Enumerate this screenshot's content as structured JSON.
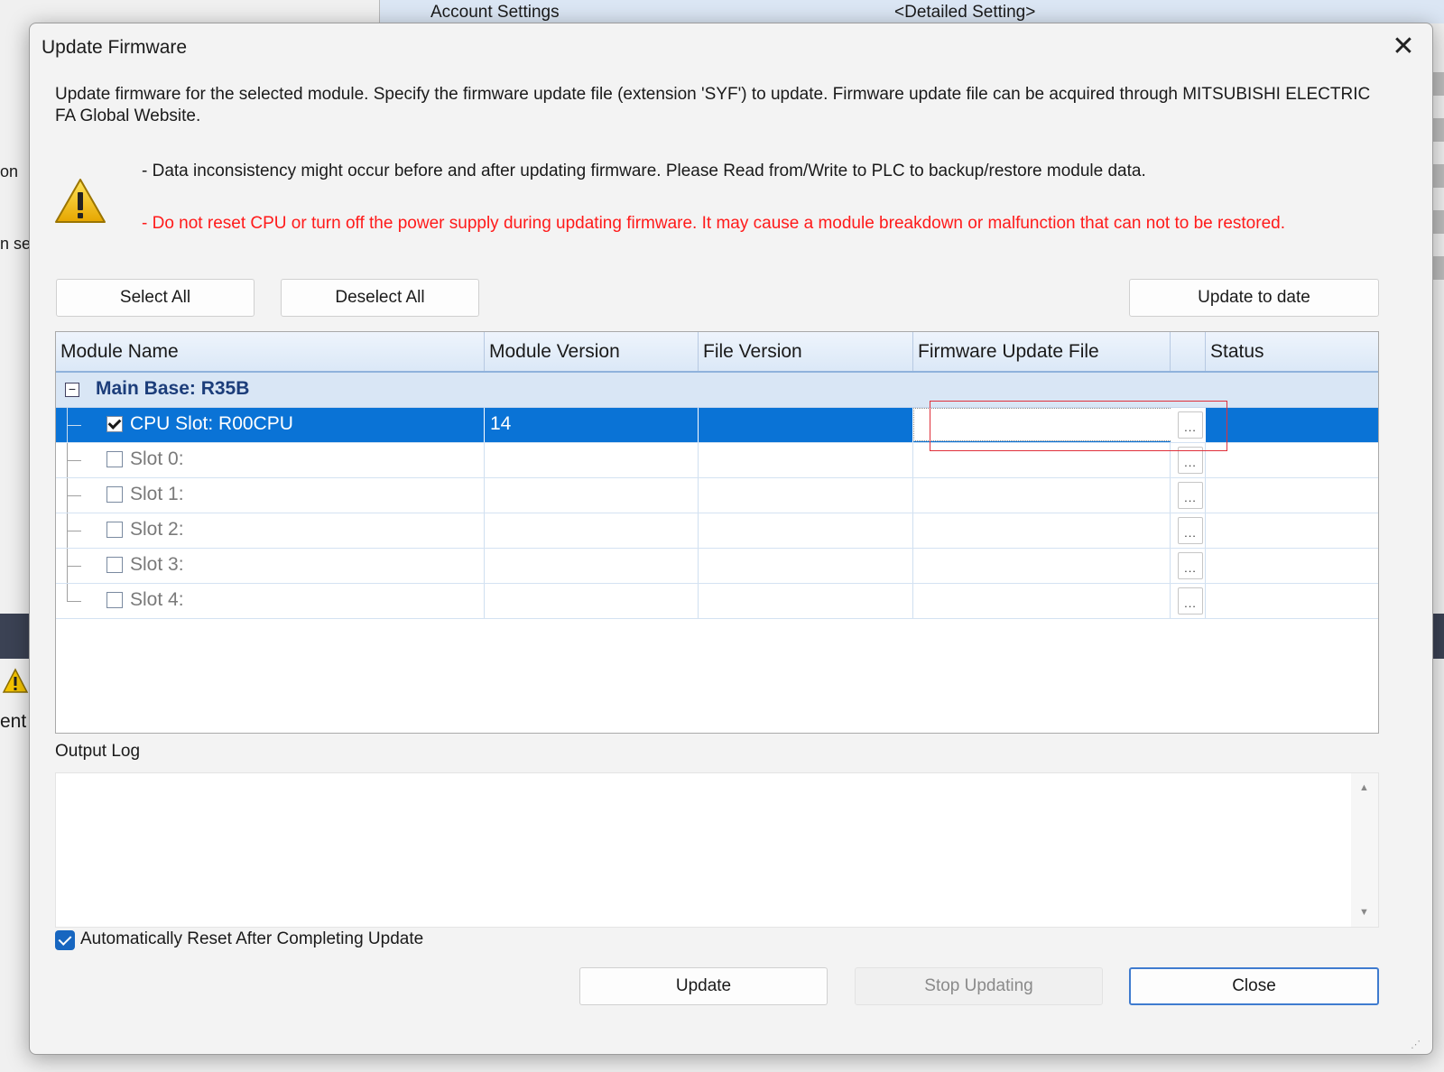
{
  "background": {
    "row_name": "Account Settings",
    "row_value": "<Detailed Setting>",
    "left_fragments": [
      "on",
      "n se",
      "ent"
    ]
  },
  "dialog": {
    "title": "Update Firmware",
    "close_glyph": "✕",
    "description": "Update firmware for the selected module. Specify the firmware update file (extension 'SYF') to update. Firmware update file can be acquired through MITSUBISHI ELECTRIC FA Global Website.",
    "notice_info": "- Data inconsistency might occur before and after updating firmware. Please Read from/Write to PLC to backup/restore module data.",
    "notice_warning": "- Do not reset CPU or turn off the power supply during updating firmware. It may cause a module breakdown or malfunction that can not to be restored.",
    "warning_color": "#ff1a1a",
    "buttons": {
      "select_all": "Select All",
      "deselect_all": "Deselect All",
      "update_to_date": "Update to date",
      "update": "Update",
      "stop_updating": "Stop Updating",
      "close": "Close"
    },
    "grid": {
      "columns": [
        "Module Name",
        "Module Version",
        "File Version",
        "Firmware Update File",
        "",
        "Status"
      ],
      "group": {
        "expander": "−",
        "label": "Main Base: R35B"
      },
      "rows": [
        {
          "label": "CPU Slot: R00CPU",
          "checked": true,
          "selected": true,
          "module_version": "14",
          "file_version": "",
          "firmware_file": "",
          "browse": "...",
          "status": ""
        },
        {
          "label": "Slot 0:",
          "checked": false,
          "selected": false,
          "module_version": "",
          "file_version": "",
          "firmware_file": "",
          "browse": "...",
          "status": ""
        },
        {
          "label": "Slot 1:",
          "checked": false,
          "selected": false,
          "module_version": "",
          "file_version": "",
          "firmware_file": "",
          "browse": "...",
          "status": ""
        },
        {
          "label": "Slot 2:",
          "checked": false,
          "selected": false,
          "module_version": "",
          "file_version": "",
          "firmware_file": "",
          "browse": "...",
          "status": ""
        },
        {
          "label": "Slot 3:",
          "checked": false,
          "selected": false,
          "module_version": "",
          "file_version": "",
          "firmware_file": "",
          "browse": "...",
          "status": ""
        },
        {
          "label": "Slot 4:",
          "checked": false,
          "selected": false,
          "module_version": "",
          "file_version": "",
          "firmware_file": "",
          "browse": "...",
          "status": ""
        }
      ],
      "selection_color": "#0a73d6"
    },
    "output_log": {
      "label": "Output Log",
      "content": ""
    },
    "auto_reset": {
      "label": "Automatically Reset After Completing Update",
      "checked": true
    }
  }
}
